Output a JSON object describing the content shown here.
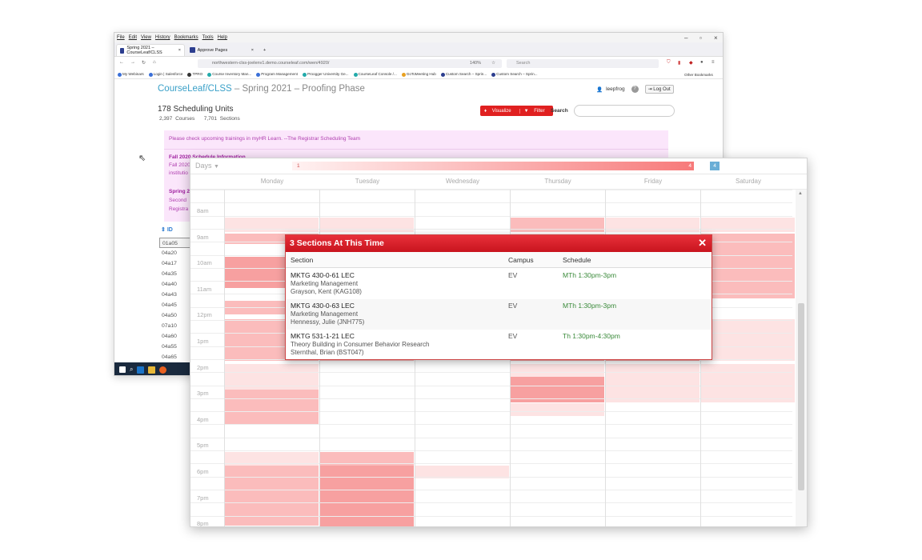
{
  "browser": {
    "menu": [
      "File",
      "Edit",
      "View",
      "History",
      "Bookmarks",
      "Tools",
      "Help"
    ],
    "tabs": [
      {
        "label": "Spring 2021 – CourseLeaf/CLSS",
        "close": "×"
      },
      {
        "label": "Approve Pages",
        "close": "×"
      }
    ],
    "new_tab": "+",
    "url": "northwestern-clss-joelenv1.demo.courseleaf.com/wen/4920/",
    "zoom": "140%",
    "search_placeholder": "Search",
    "bookmarks": [
      "My Webinars",
      "Login | Salesforce",
      "TPRO",
      "Course Inventory Man...",
      "Program Management",
      "Proogger University Ge...",
      "CourseLeaf Console /...",
      "GoToMeeting Hub",
      "Custom Search – Sprin...",
      "Custom Search – Sprin..."
    ],
    "other_bookmarks": "Other Bookmarks"
  },
  "courseleaf": {
    "brand": "CourseLeaf/CLSS",
    "title_rest": " – Spring 2021 – Proofing Phase",
    "user": "leepfrog",
    "help": "?",
    "logout": "Log Out",
    "units": "178 Scheduling Units",
    "courses": "2,397 Courses",
    "sections": "7,701 Sections",
    "visualize": "Visualize",
    "filter": "Filter",
    "search_label": "Search",
    "notice": "Please check upcoming trainings in myHR Learn. --The Registrar Scheduling Team",
    "fall_head": "Fall 2020 Schedule Information",
    "fall_frag1": "Fall 2020",
    "fall_frag2": "institutio",
    "spring_frag1": "Spring 2",
    "spring_frag2": "Second",
    "spring_frag3": "Registra",
    "id_header": "ID",
    "ids": [
      "01a05",
      "04a20",
      "04a17",
      "04a35",
      "04a40",
      "04a43",
      "04a45",
      "04a50",
      "07a10",
      "04a60",
      "04a55",
      "04a65"
    ]
  },
  "calendar": {
    "view": "Days",
    "legend_min": "1",
    "legend_max": "4",
    "legend_box": "4",
    "days": [
      "Monday",
      "Tuesday",
      "Wednesday",
      "Thursday",
      "Friday",
      "Saturday"
    ],
    "hours": [
      "8am",
      "9am",
      "10am",
      "11am",
      "12pm",
      "1pm",
      "2pm",
      "3pm",
      "4pm",
      "5pm",
      "6pm",
      "7pm",
      "8pm"
    ],
    "heat_low": "#fde3e3",
    "heat_mid": "#fbbcbc",
    "heat_high": "#f7a0a0"
  },
  "popup": {
    "title": "3 Sections At This Time",
    "close": "✕",
    "col_section": "Section",
    "col_campus": "Campus",
    "col_schedule": "Schedule",
    "rows": [
      {
        "code": "MKTG 430-0-61 LEC",
        "name": "Marketing Management",
        "instructor": "Grayson, Kent (KAG108)",
        "campus": "EV",
        "schedule": "MTh 1:30pm-3pm"
      },
      {
        "code": "MKTG 430-0-63 LEC",
        "name": "Marketing Management",
        "instructor": "Hennessy, Julie (JNH775)",
        "campus": "EV",
        "schedule": "MTh 1:30pm-3pm"
      },
      {
        "code": "MKTG 531-1-21 LEC",
        "name": "Theory Building in Consumer Behavior Research",
        "instructor": "Sternthal, Brian (BST047)",
        "campus": "EV",
        "schedule": "Th 1:30pm-4:30pm"
      }
    ]
  }
}
